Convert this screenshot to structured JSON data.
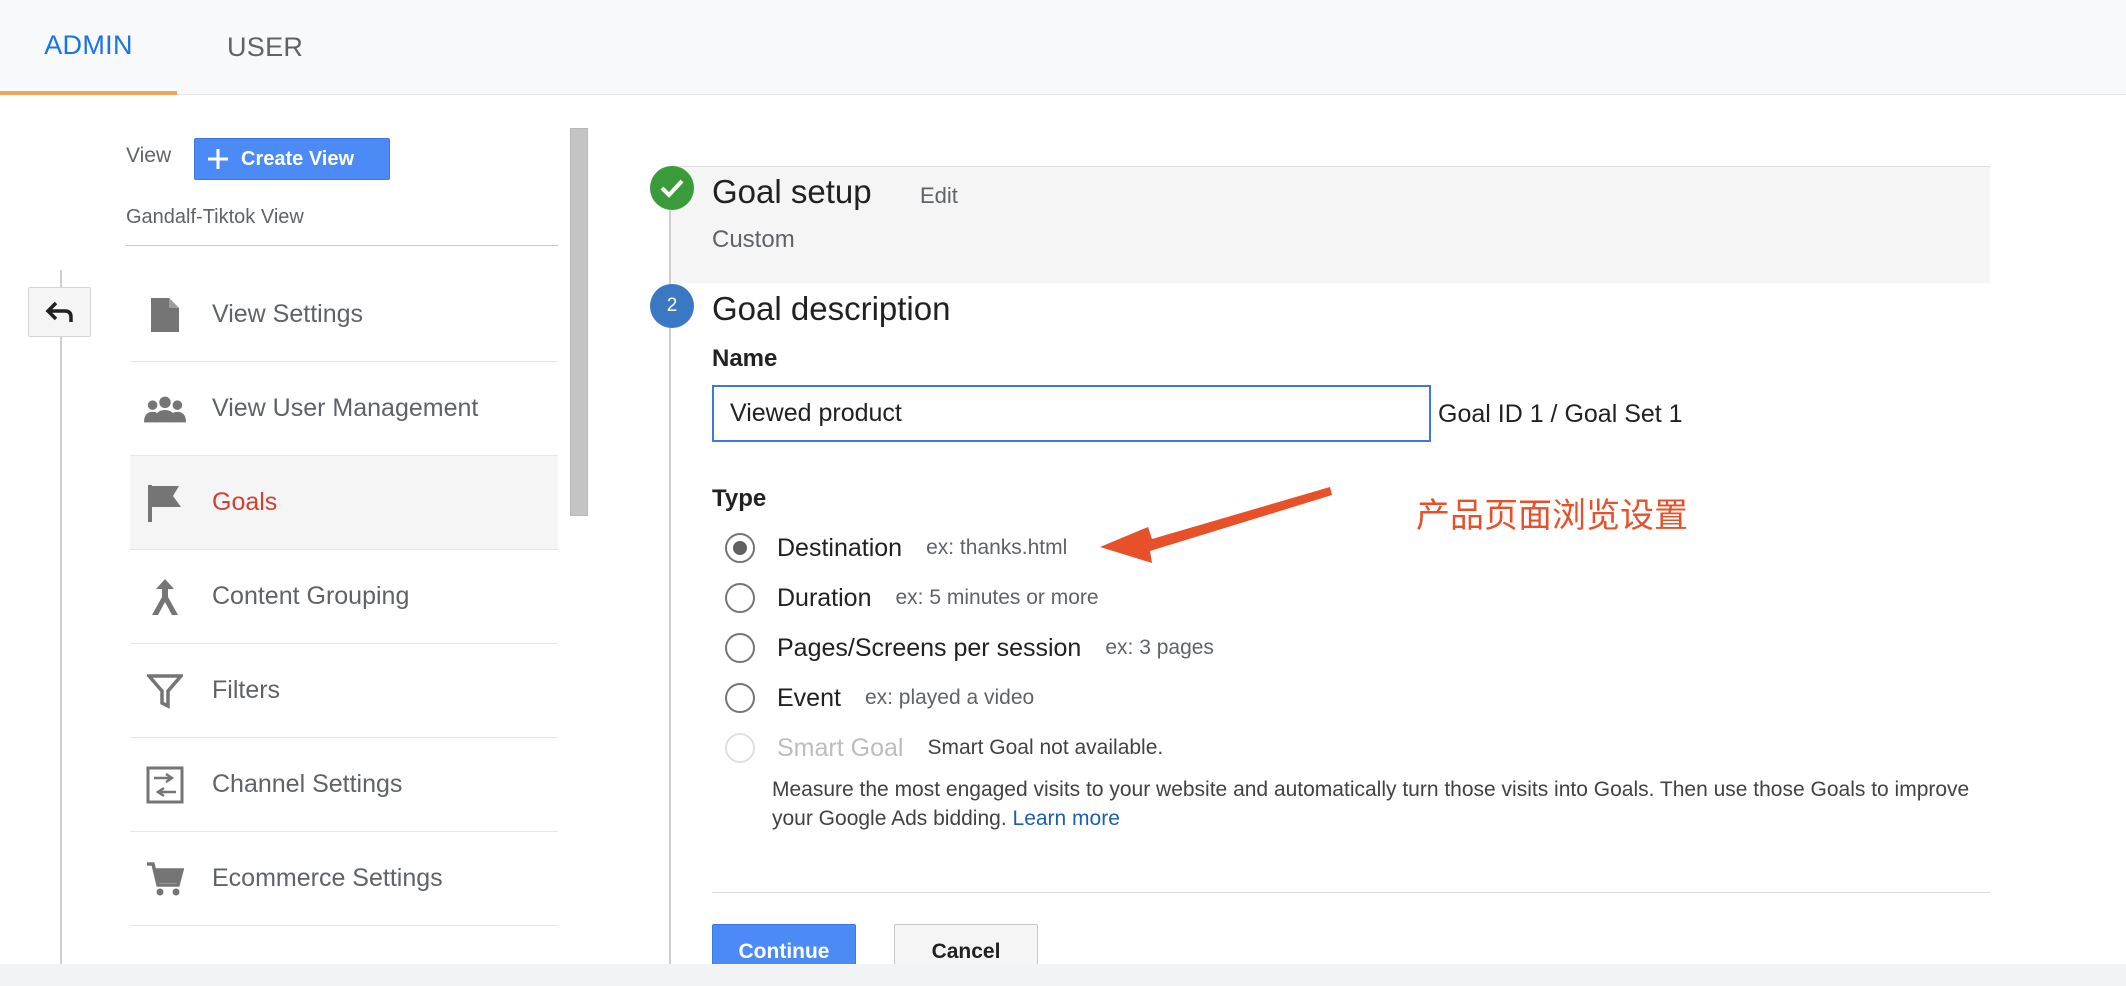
{
  "tabs": {
    "admin": "ADMIN",
    "user": "USER"
  },
  "sidebar": {
    "view_label": "View",
    "create_view": "Create View",
    "view_name": "Gandalf-Tiktok View",
    "items": [
      {
        "label": "View Settings",
        "icon": "document-icon"
      },
      {
        "label": "View User Management",
        "icon": "people-icon"
      },
      {
        "label": "Goals",
        "icon": "flag-icon",
        "active": true
      },
      {
        "label": "Content Grouping",
        "icon": "merge-icon"
      },
      {
        "label": "Filters",
        "icon": "filter-icon"
      },
      {
        "label": "Channel Settings",
        "icon": "channel-settings-icon"
      },
      {
        "label": "Ecommerce Settings",
        "icon": "cart-icon"
      }
    ]
  },
  "goal_setup": {
    "title": "Goal setup",
    "edit": "Edit",
    "subtitle": "Custom"
  },
  "goal_description": {
    "step": "2",
    "title": "Goal description",
    "name_label": "Name",
    "name_value": "Viewed product",
    "goal_id": "Goal ID 1 / Goal Set 1",
    "type_label": "Type",
    "types": [
      {
        "label": "Destination",
        "example": "ex: thanks.html",
        "selected": true
      },
      {
        "label": "Duration",
        "example": "ex: 5 minutes or more"
      },
      {
        "label": "Pages/Screens per session",
        "example": "ex: 3 pages"
      },
      {
        "label": "Event",
        "example": "ex: played a video"
      },
      {
        "label": "Smart Goal",
        "example": "Smart Goal not available.",
        "disabled": true
      }
    ],
    "smart_note": "Measure the most engaged visits to your website and automatically turn those visits into Goals. Then use those Goals to improve your Google Ads bidding.",
    "learn_more": "Learn more"
  },
  "buttons": {
    "continue": "Continue",
    "cancel": "Cancel"
  },
  "annotation": {
    "text": "产品页面浏览设置",
    "color": "#e8502a"
  },
  "colors": {
    "accent": "#1a73e8",
    "tab_underline": "#f2a35d",
    "active_nav": "#d23f31",
    "primary_button": "#4c8bf5",
    "step_done": "#3a9b3a",
    "step_current": "#3b78c4"
  }
}
